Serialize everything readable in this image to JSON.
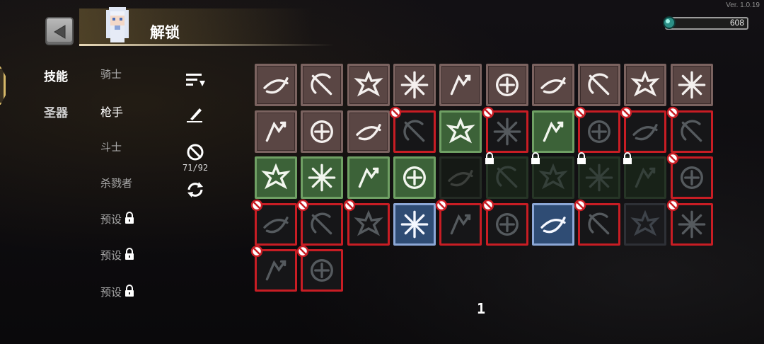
{
  "version": "Ver. 1.0.19",
  "header": {
    "title": "解锁"
  },
  "currency": {
    "value": "608",
    "icon": "gem-icon"
  },
  "nav": {
    "categories": [
      {
        "label": "技能",
        "active": true
      },
      {
        "label": "圣器",
        "active": false
      }
    ]
  },
  "characters": [
    {
      "label": "骑士",
      "active": false,
      "locked": false
    },
    {
      "label": "枪手",
      "active": true,
      "locked": false
    },
    {
      "label": "斗士",
      "active": false,
      "locked": false
    },
    {
      "label": "杀戮者",
      "active": false,
      "locked": false
    },
    {
      "label": "预设",
      "active": false,
      "locked": true
    },
    {
      "label": "预设",
      "active": false,
      "locked": true
    },
    {
      "label": "预设",
      "active": false,
      "locked": true
    }
  ],
  "tools": {
    "sort_icon": "sort-icon",
    "edit_icon": "pen-icon",
    "ban_icon": "ban-icon",
    "counter": "71/92",
    "reset_icon": "refresh-icon"
  },
  "colors": {
    "banned_border": "#c81d24",
    "selected_green": "#6fa064",
    "selected_blue": "#8ca7d6",
    "accent_gold": "#d6b868"
  },
  "skills": [
    {
      "name": "slash-orbit-skill",
      "state": "unlocked",
      "badge": "none"
    },
    {
      "name": "spin-blade-skill",
      "state": "unlocked",
      "badge": "none"
    },
    {
      "name": "thorn-burst-skill",
      "state": "unlocked",
      "badge": "none"
    },
    {
      "name": "radial-burst-skill",
      "state": "unlocked",
      "badge": "none"
    },
    {
      "name": "arrow-jump-skill",
      "state": "unlocked",
      "badge": "none"
    },
    {
      "name": "compass-skill",
      "state": "unlocked",
      "badge": "none"
    },
    {
      "name": "chaos-ring-skill",
      "state": "unlocked",
      "badge": "none"
    },
    {
      "name": "arrow-volley-skill",
      "state": "unlocked",
      "badge": "none"
    },
    {
      "name": "skull-gust-skill",
      "state": "unlocked",
      "badge": "none"
    },
    {
      "name": "crescent-skill",
      "state": "unlocked",
      "badge": "none"
    },
    {
      "name": "card-stack-skill",
      "state": "unlocked",
      "badge": "none"
    },
    {
      "name": "leaf-bird-skill",
      "state": "unlocked",
      "badge": "none"
    },
    {
      "name": "target-eye-skill",
      "state": "unlocked",
      "badge": "none"
    },
    {
      "name": "shadow-dash-skill",
      "state": "banned",
      "badge": "ban"
    },
    {
      "name": "chain-stars-skill",
      "state": "green",
      "badge": "none"
    },
    {
      "name": "lightning-skill",
      "state": "banned",
      "badge": "ban"
    },
    {
      "name": "fist-strike-skill",
      "state": "green",
      "badge": "none"
    },
    {
      "name": "skull-mist-skill",
      "state": "banned",
      "badge": "ban"
    },
    {
      "name": "biohazard-skill",
      "state": "banned",
      "badge": "ban"
    },
    {
      "name": "gourd-skill",
      "state": "banned",
      "badge": "ban"
    },
    {
      "name": "vortex-slash-skill",
      "state": "green",
      "badge": "none"
    },
    {
      "name": "triple-spike-skill",
      "state": "green",
      "badge": "none"
    },
    {
      "name": "crack-skill",
      "state": "green",
      "badge": "none"
    },
    {
      "name": "rune-circle-skill",
      "state": "green",
      "badge": "none"
    },
    {
      "name": "swirl-skill",
      "state": "dark",
      "badge": "none"
    },
    {
      "name": "sword-skill",
      "state": "darkgreen",
      "badge": "lock"
    },
    {
      "name": "bat-skill",
      "state": "darkgreen",
      "badge": "lock"
    },
    {
      "name": "spark-skill",
      "state": "darkgreen",
      "badge": "lock"
    },
    {
      "name": "drill-skill",
      "state": "darkgreen",
      "badge": "lock"
    },
    {
      "name": "orb-cluster-skill",
      "state": "banned",
      "badge": "ban"
    },
    {
      "name": "phantom-skill",
      "state": "banned",
      "badge": "ban"
    },
    {
      "name": "hourglass-skill",
      "state": "banned",
      "badge": "ban"
    },
    {
      "name": "stairs-skill",
      "state": "banned",
      "badge": "ban"
    },
    {
      "name": "power-up-skill",
      "state": "blue",
      "badge": "none"
    },
    {
      "name": "spike-star-skill",
      "state": "banned",
      "badge": "ban"
    },
    {
      "name": "bow-skill",
      "state": "banned",
      "badge": "ban"
    },
    {
      "name": "spiral-skill",
      "state": "blue",
      "badge": "none"
    },
    {
      "name": "gust-skill",
      "state": "banned",
      "badge": "ban"
    },
    {
      "name": "mask-skill",
      "state": "dim-red",
      "badge": "none"
    },
    {
      "name": "cloud-skill",
      "state": "banned",
      "badge": "ban"
    },
    {
      "name": "scorpion-skill",
      "state": "banned",
      "badge": "ban"
    },
    {
      "name": "scythe-skill",
      "state": "banned",
      "badge": "ban"
    }
  ],
  "pagination": {
    "page": "1"
  }
}
